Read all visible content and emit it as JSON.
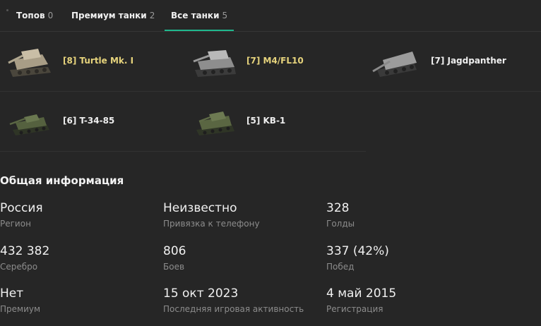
{
  "tabs": [
    {
      "label": "Топов",
      "count": "0"
    },
    {
      "label": "Премиум танки",
      "count": "2"
    },
    {
      "label": "Все танки",
      "count": "5"
    }
  ],
  "tanks": [
    {
      "name": "[8] Turtle Mk. I",
      "color": "#e6d37c"
    },
    {
      "name": "[7] M4/FL10",
      "color": "#e6d37c"
    },
    {
      "name": "[7] Jagdpanther",
      "color": "#eeeeee"
    },
    {
      "name": "[6] T-34-85",
      "color": "#eeeeee"
    },
    {
      "name": "[5] KB-1",
      "color": "#eeeeee"
    }
  ],
  "info": {
    "title": "Общая информация",
    "stats": [
      {
        "value": "Россия",
        "label": "Регион"
      },
      {
        "value": "Неизвестно",
        "label": "Привязка к телефону"
      },
      {
        "value": "328",
        "label": "Голды"
      },
      {
        "value": "432 382",
        "label": "Серебро"
      },
      {
        "value": "806",
        "label": "Боев"
      },
      {
        "value": "337 (42%)",
        "label": "Побед"
      },
      {
        "value": "Нет",
        "label": "Премиум"
      },
      {
        "value": "15 окт 2023",
        "label": "Последняя игровая активность"
      },
      {
        "value": "4 май 2015",
        "label": "Регистрация"
      }
    ]
  },
  "colors": {
    "accent": "#1fb88e",
    "premium_name": "#e6d37c",
    "background": "#262626"
  }
}
